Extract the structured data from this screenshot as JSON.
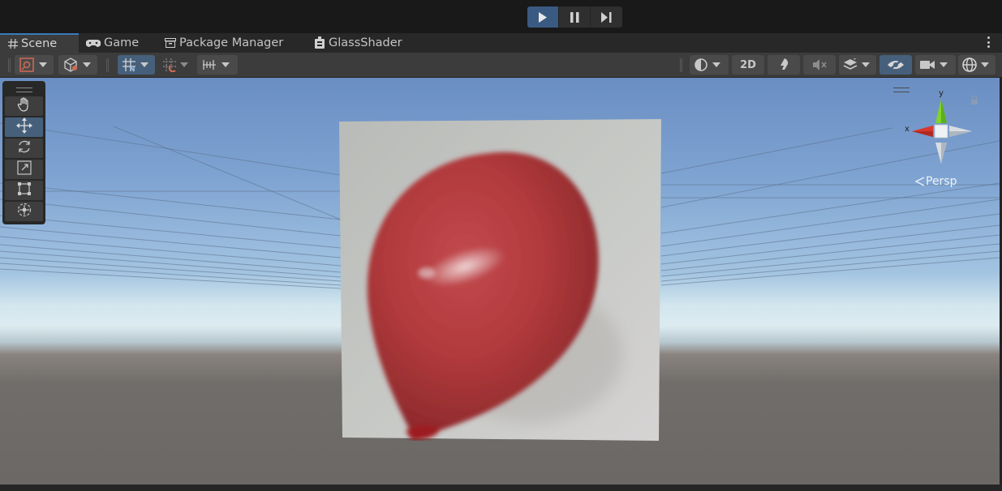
{
  "playmode": {
    "buttons": [
      {
        "name": "play",
        "icon": "play-icon",
        "active": true
      },
      {
        "name": "pause",
        "icon": "pause-icon",
        "active": false
      },
      {
        "name": "step",
        "icon": "step-icon",
        "active": false
      }
    ]
  },
  "tabs": [
    {
      "label": "Scene",
      "icon": "hash-icon",
      "active": true
    },
    {
      "label": "Game",
      "icon": "gamepad-icon",
      "active": false
    },
    {
      "label": "Package Manager",
      "icon": "package-icon",
      "active": false
    },
    {
      "label": "GlassShader",
      "icon": "shader-graph-icon",
      "active": false
    }
  ],
  "scene_toolbar": {
    "mode_2d_label": "2D",
    "left_tools": [
      "draw-mode-icon",
      "shading-cube-icon",
      "grid-snap-icon",
      "increment-snap-icon",
      "grid-ruler-icon"
    ],
    "right_tools": [
      "render-mode-icon",
      "lighting-icon",
      "audio-mute-icon",
      "effects-icon",
      "scene-visibility-icon",
      "camera-icon",
      "gizmos-icon"
    ]
  },
  "tools": [
    "hand-icon",
    "move-icon",
    "rotate-icon",
    "scale-icon",
    "rect-icon",
    "transform-icon"
  ],
  "selected_tool": "move-icon",
  "gizmo": {
    "y_label": "y",
    "x_label": "x",
    "projection_label": "Persp"
  },
  "colors": {
    "accent": "#3a79bb",
    "active_button": "#46607c",
    "x_axis": "#d9372b",
    "y_axis": "#7fd42a",
    "balloon": "#b13a3c"
  }
}
